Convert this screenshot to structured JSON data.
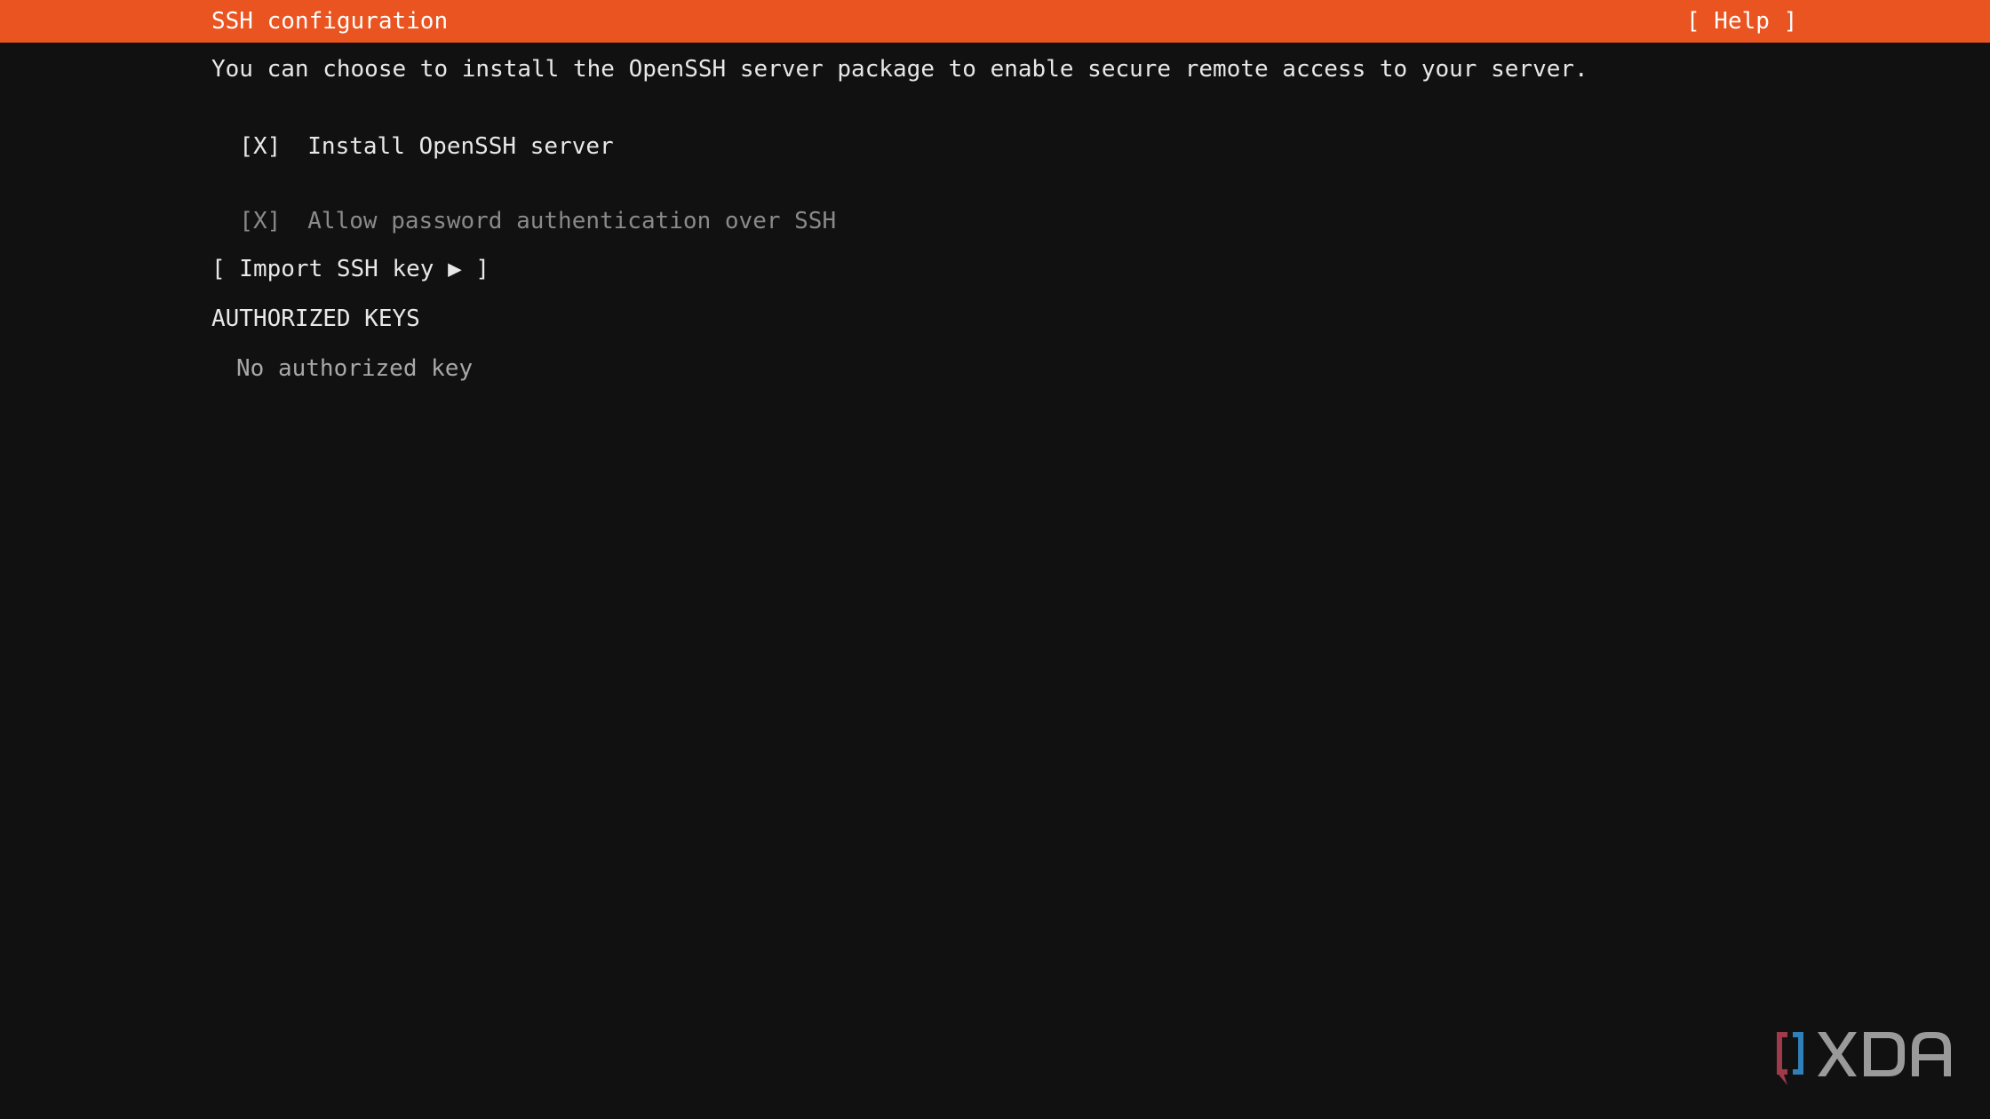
{
  "header": {
    "title": "SSH configuration",
    "help_label": "[ Help ]",
    "bar_color": "#e95420"
  },
  "main": {
    "description": "You can choose to install the OpenSSH server package to enable secure remote access to your server.",
    "install_openssh": {
      "checkbox": "[X]",
      "label": "Install OpenSSH server",
      "checked": true
    },
    "allow_password": {
      "checkbox": "[X]",
      "label": "Allow password authentication over SSH",
      "checked": true,
      "disabled": true
    },
    "import_button": "[ Import SSH key ▶ ]",
    "authorized_keys_header": "AUTHORIZED KEYS",
    "no_keys_text": "No authorized key"
  },
  "watermark": {
    "text": "XDA",
    "icon": "xda-logo-icon"
  }
}
